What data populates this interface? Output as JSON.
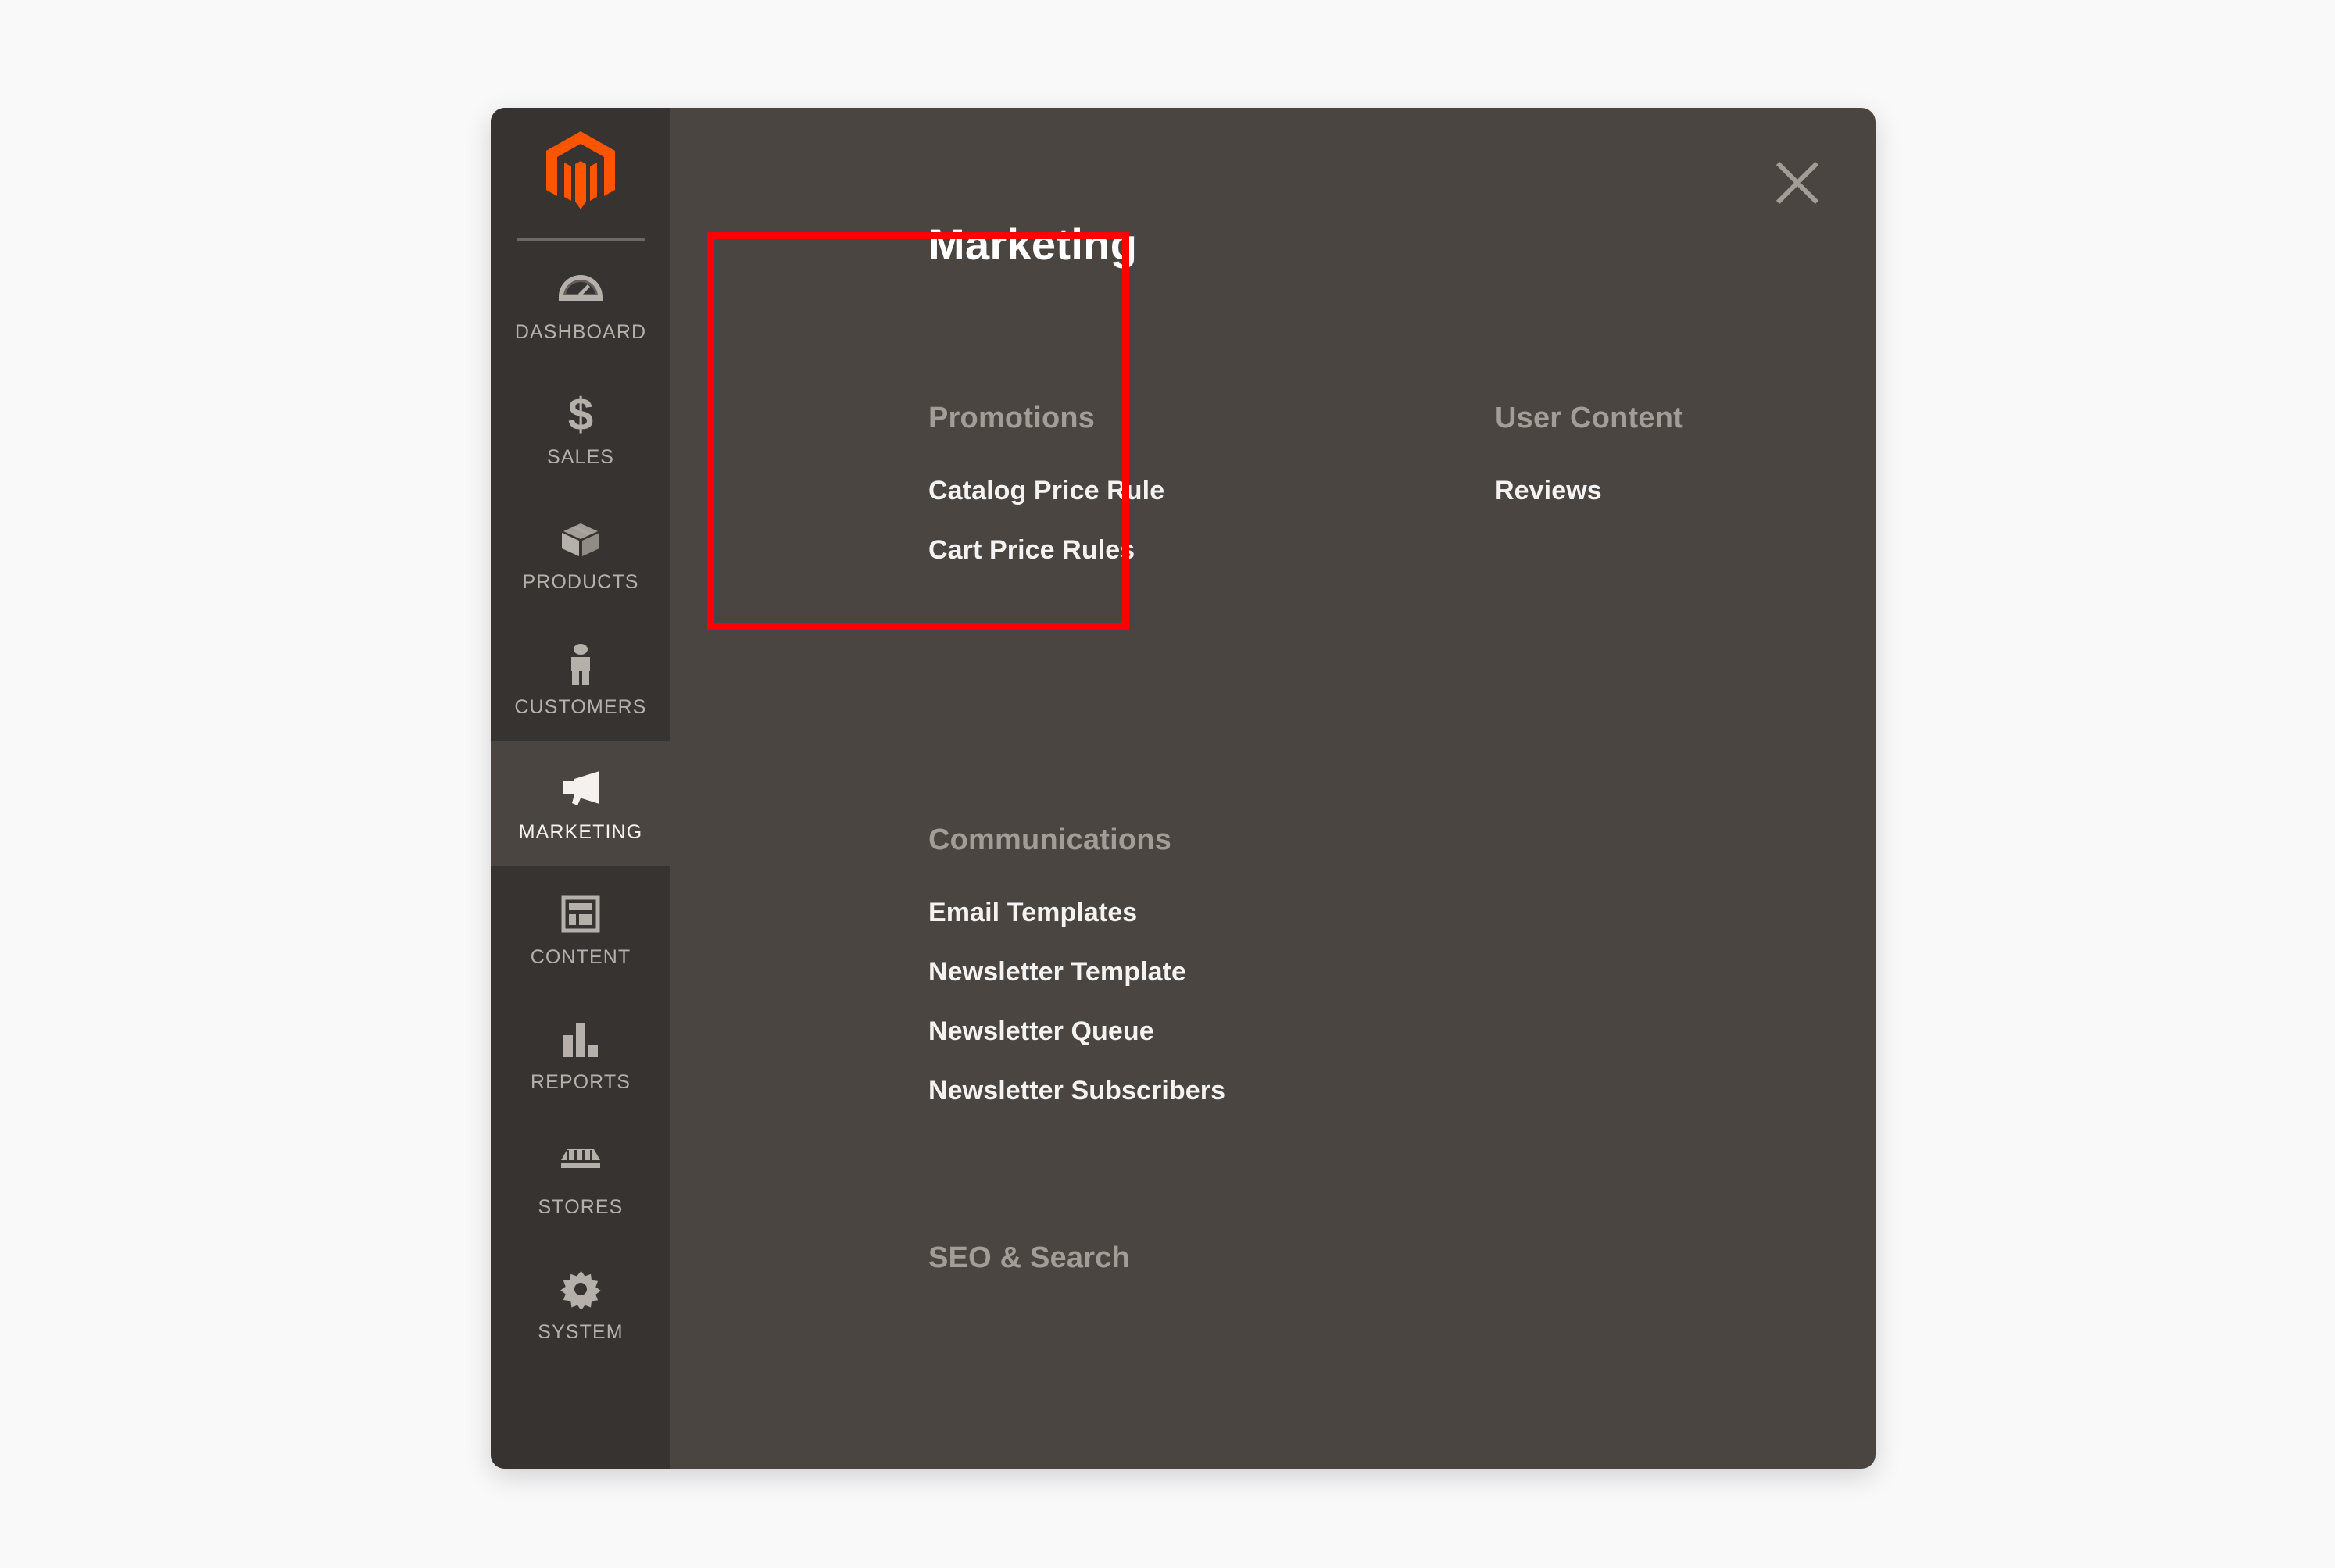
{
  "window": {
    "background_color": "#f9f9fa",
    "panel_color": "#4a4541",
    "sidebar_color": "#373330",
    "accent_color": "#ff5501",
    "highlight_color": "#ff0000"
  },
  "sidebar": {
    "logo": "magento-logo",
    "items": [
      {
        "label": "DASHBOARD",
        "icon": "gauge-icon",
        "active": false
      },
      {
        "label": "SALES",
        "icon": "dollar-icon",
        "active": false
      },
      {
        "label": "PRODUCTS",
        "icon": "box-icon",
        "active": false
      },
      {
        "label": "CUSTOMERS",
        "icon": "person-icon",
        "active": false
      },
      {
        "label": "MARKETING",
        "icon": "megaphone-icon",
        "active": true
      },
      {
        "label": "CONTENT",
        "icon": "layout-icon",
        "active": false
      },
      {
        "label": "REPORTS",
        "icon": "bar-chart-icon",
        "active": false
      },
      {
        "label": "STORES",
        "icon": "storefront-icon",
        "active": false
      },
      {
        "label": "SYSTEM",
        "icon": "gear-icon",
        "active": false
      }
    ]
  },
  "menu": {
    "title": "Marketing",
    "close_label": "close-icon",
    "groups": {
      "promotions": {
        "title": "Promotions",
        "links": [
          "Catalog Price Rule",
          "Cart Price Rules"
        ]
      },
      "communications": {
        "title": "Communications",
        "links": [
          "Email Templates",
          "Newsletter Template",
          "Newsletter Queue",
          "Newsletter Subscribers"
        ]
      },
      "seo": {
        "title": "SEO & Search",
        "links": []
      },
      "user_content": {
        "title": "User Content",
        "links": [
          "Reviews"
        ]
      }
    }
  }
}
